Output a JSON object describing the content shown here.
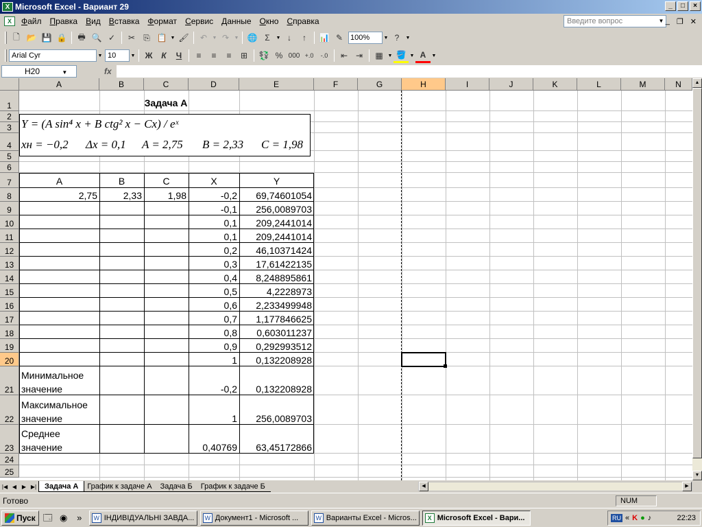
{
  "window": {
    "title": "Microsoft Excel - Вариант 29"
  },
  "menu": [
    "Файл",
    "Правка",
    "Вид",
    "Вставка",
    "Формат",
    "Сервис",
    "Данные",
    "Окно",
    "Справка"
  ],
  "ask_placeholder": "Введите вопрос",
  "toolbar": {
    "zoom": "100%",
    "font": "Arial Cyr",
    "size": "10",
    "bold": "Ж",
    "italic": "К",
    "underline": "Ч",
    "percent": "%",
    "thousands": "000"
  },
  "namebox": "H20",
  "fx": "fx",
  "columns": [
    "A",
    "B",
    "C",
    "D",
    "E",
    "F",
    "G",
    "H",
    "I",
    "J",
    "K",
    "L",
    "M",
    "N"
  ],
  "rows": [
    "1",
    "2",
    "3",
    "4",
    "5",
    "6",
    "7",
    "8",
    "9",
    "10",
    "11",
    "12",
    "13",
    "14",
    "15",
    "16",
    "17",
    "18",
    "19",
    "20",
    "21",
    "22",
    "23",
    "24",
    "25"
  ],
  "title": "Задача А",
  "formula": {
    "line1": "Y = (A sin⁴ x + B ctg² x − Cx) / eˣ",
    "xn": "xн = −0,2",
    "dx": "Δx = 0,1",
    "a": "A = 2,75",
    "b": "B = 2,33",
    "c": "C = 1,98"
  },
  "table": {
    "headers": [
      "A",
      "B",
      "C",
      "X",
      "Y"
    ],
    "params": [
      "2,75",
      "2,33",
      "1,98"
    ],
    "x": [
      "-0,2",
      "-0,1",
      "0,1",
      "0,1",
      "0,2",
      "0,3",
      "0,4",
      "0,5",
      "0,6",
      "0,7",
      "0,8",
      "0,9",
      "1"
    ],
    "y": [
      "69,74601054",
      "256,0089703",
      "209,2441014",
      "209,2441014",
      "46,10371424",
      "17,61422135",
      "8,248895861",
      "4,2228973",
      "2,233499948",
      "1,177846625",
      "0,603011237",
      "0,292993512",
      "0,132208928"
    ],
    "min_label": [
      "Минимальное",
      "значение"
    ],
    "max_label": [
      "Максимальное",
      "значение"
    ],
    "avg_label": [
      "Среднее",
      "значение"
    ],
    "min_x": "-0,2",
    "min_y": "0,132208928",
    "max_x": "1",
    "max_y": "256,0089703",
    "avg_x": "0,40769",
    "avg_y": "63,45172866"
  },
  "sheets": [
    "Задача А",
    "График к задаче А",
    "Задача Б",
    "График к задаче Б"
  ],
  "status": {
    "ready": "Готово",
    "num": "NUM"
  },
  "taskbar": {
    "start": "Пуск",
    "buttons": [
      "ІНДИВІДУАЛЬНІ ЗАВДА...",
      "Документ1 - Microsoft ...",
      "Варианты Excel - Micros...",
      "Microsoft Excel - Вари..."
    ],
    "lang": "RU",
    "time": "22:23"
  }
}
